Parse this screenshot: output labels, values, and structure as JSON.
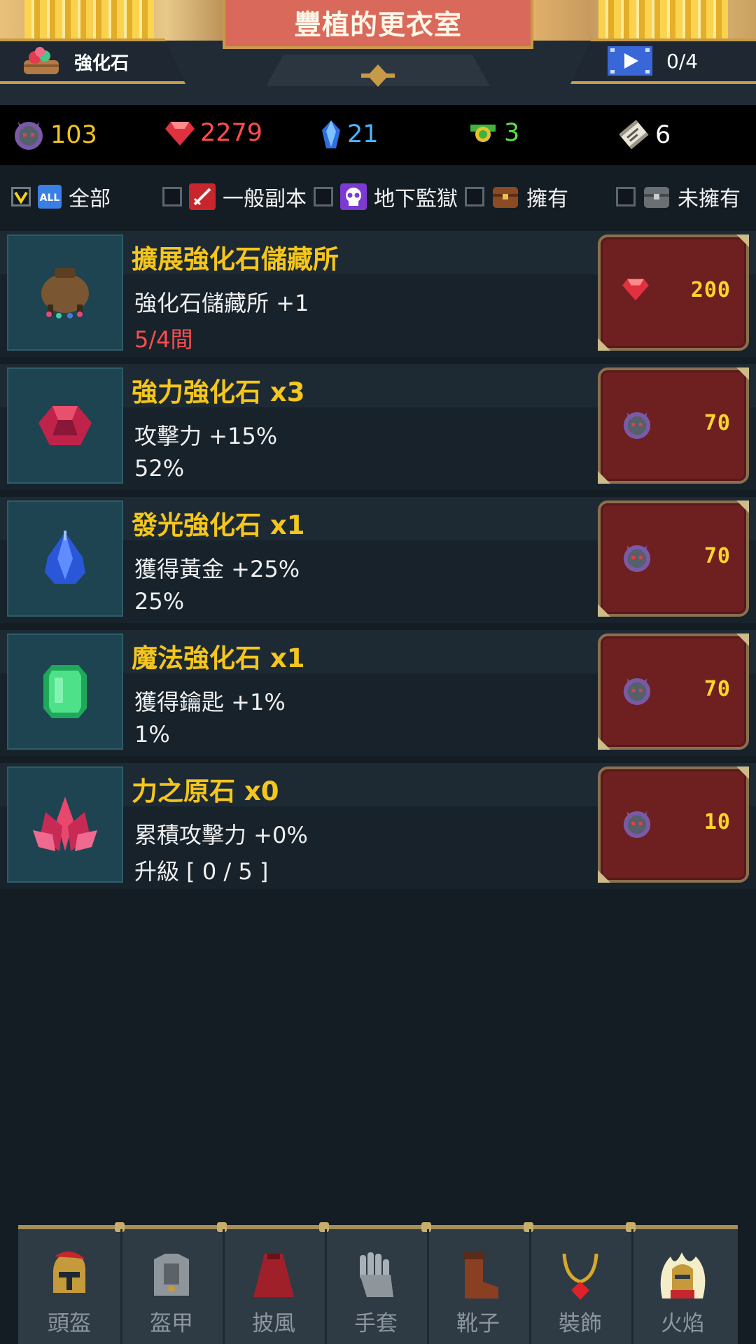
{
  "header": {
    "title": "豐植的更衣室",
    "stones_button_label": "強化石",
    "video_count": "0/4"
  },
  "currency": [
    {
      "icon": "demon-coin-icon",
      "value": "103",
      "color": "#f5c61c"
    },
    {
      "icon": "ruby-icon",
      "value": "2279",
      "color": "#ff4d4d"
    },
    {
      "icon": "blue-crystal-icon",
      "value": "21",
      "color": "#4db5ff"
    },
    {
      "icon": "green-medal-icon",
      "value": "3",
      "color": "#5ee04c"
    },
    {
      "icon": "scroll-icon",
      "value": "6",
      "color": "#ffffff"
    }
  ],
  "filters": [
    {
      "label": "全部",
      "checked": true,
      "icon": "all-badge-icon"
    },
    {
      "label": "一般副本",
      "checked": false,
      "icon": "sword-icon"
    },
    {
      "label": "地下監獄",
      "checked": false,
      "icon": "skull-icon"
    },
    {
      "label": "擁有",
      "checked": false,
      "icon": "chest-icon"
    },
    {
      "label": "未擁有",
      "checked": false,
      "icon": "locked-chest-icon"
    }
  ],
  "items": [
    {
      "title": "擴展強化石儲藏所",
      "desc": "強化石儲藏所 +1",
      "stat": "5/4間",
      "stat_red": true,
      "price": "200",
      "price_icon": "ruby-icon",
      "thumb": "storage-bag-icon"
    },
    {
      "title": "強力強化石 x3",
      "desc": "攻擊力 +15%",
      "stat": "52%",
      "stat_red": false,
      "price": "70",
      "price_icon": "demon-coin-icon",
      "thumb": "red-gem-icon"
    },
    {
      "title": "發光強化石 x1",
      "desc": "獲得黃金 +25%",
      "stat": "25%",
      "stat_red": false,
      "price": "70",
      "price_icon": "demon-coin-icon",
      "thumb": "blue-gem-icon"
    },
    {
      "title": "魔法強化石 x1",
      "desc": "獲得鑰匙 +1%",
      "stat": "1%",
      "stat_red": false,
      "price": "70",
      "price_icon": "demon-coin-icon",
      "thumb": "green-gem-icon"
    },
    {
      "title": "力之原石 x0",
      "desc": "累積攻擊力 +0%",
      "stat": "升級 [ 0 / 5 ]",
      "stat_red": false,
      "price": "10",
      "price_icon": "demon-coin-icon",
      "thumb": "pink-crystal-icon"
    }
  ],
  "nav": [
    {
      "label": "頭盔",
      "icon": "helmet-icon"
    },
    {
      "label": "盔甲",
      "icon": "armor-icon"
    },
    {
      "label": "披風",
      "icon": "cape-icon"
    },
    {
      "label": "手套",
      "icon": "glove-icon"
    },
    {
      "label": "靴子",
      "icon": "boot-icon"
    },
    {
      "label": "裝飾",
      "icon": "necklace-icon"
    },
    {
      "label": "火焰",
      "icon": "flame-knight-icon"
    }
  ]
}
